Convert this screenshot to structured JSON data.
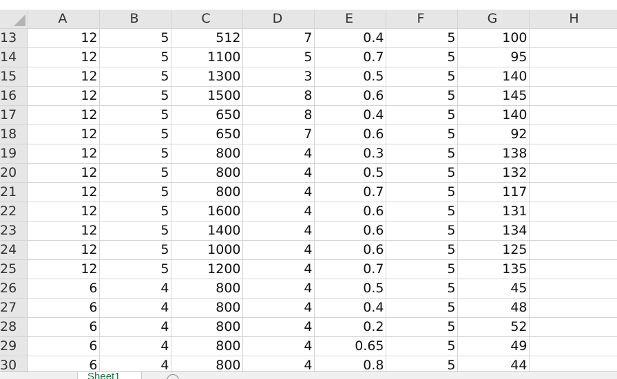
{
  "sheet": {
    "columns": [
      "A",
      "B",
      "C",
      "D",
      "E",
      "F",
      "G",
      "H"
    ],
    "rows": [
      {
        "num": "13",
        "cells": [
          "12",
          "5",
          "512",
          "7",
          "0.4",
          "5",
          "100",
          ""
        ]
      },
      {
        "num": "14",
        "cells": [
          "12",
          "5",
          "1100",
          "5",
          "0.7",
          "5",
          "95",
          ""
        ]
      },
      {
        "num": "15",
        "cells": [
          "12",
          "5",
          "1300",
          "3",
          "0.5",
          "5",
          "140",
          ""
        ]
      },
      {
        "num": "16",
        "cells": [
          "12",
          "5",
          "1500",
          "8",
          "0.6",
          "5",
          "145",
          ""
        ]
      },
      {
        "num": "17",
        "cells": [
          "12",
          "5",
          "650",
          "8",
          "0.4",
          "5",
          "140",
          ""
        ]
      },
      {
        "num": "18",
        "cells": [
          "12",
          "5",
          "650",
          "7",
          "0.6",
          "5",
          "92",
          ""
        ]
      },
      {
        "num": "19",
        "cells": [
          "12",
          "5",
          "800",
          "4",
          "0.3",
          "5",
          "138",
          ""
        ]
      },
      {
        "num": "20",
        "cells": [
          "12",
          "5",
          "800",
          "4",
          "0.5",
          "5",
          "132",
          ""
        ]
      },
      {
        "num": "21",
        "cells": [
          "12",
          "5",
          "800",
          "4",
          "0.7",
          "5",
          "117",
          ""
        ]
      },
      {
        "num": "22",
        "cells": [
          "12",
          "5",
          "1600",
          "4",
          "0.6",
          "5",
          "131",
          ""
        ]
      },
      {
        "num": "23",
        "cells": [
          "12",
          "5",
          "1400",
          "4",
          "0.6",
          "5",
          "134",
          ""
        ]
      },
      {
        "num": "24",
        "cells": [
          "12",
          "5",
          "1000",
          "4",
          "0.6",
          "5",
          "125",
          ""
        ]
      },
      {
        "num": "25",
        "cells": [
          "12",
          "5",
          "1200",
          "4",
          "0.7",
          "5",
          "135",
          ""
        ]
      },
      {
        "num": "26",
        "cells": [
          "6",
          "4",
          "800",
          "4",
          "0.5",
          "5",
          "45",
          ""
        ]
      },
      {
        "num": "27",
        "cells": [
          "6",
          "4",
          "800",
          "4",
          "0.4",
          "5",
          "48",
          ""
        ]
      },
      {
        "num": "28",
        "cells": [
          "6",
          "4",
          "800",
          "4",
          "0.2",
          "5",
          "52",
          ""
        ]
      },
      {
        "num": "29",
        "cells": [
          "6",
          "4",
          "800",
          "4",
          "0.65",
          "5",
          "49",
          ""
        ]
      },
      {
        "num": "30",
        "cells": [
          "6",
          "4",
          "800",
          "4",
          "0.8",
          "5",
          "44",
          ""
        ]
      }
    ]
  },
  "tabs": {
    "active": "Sheet1",
    "add_icon": "add-sheet-icon"
  }
}
